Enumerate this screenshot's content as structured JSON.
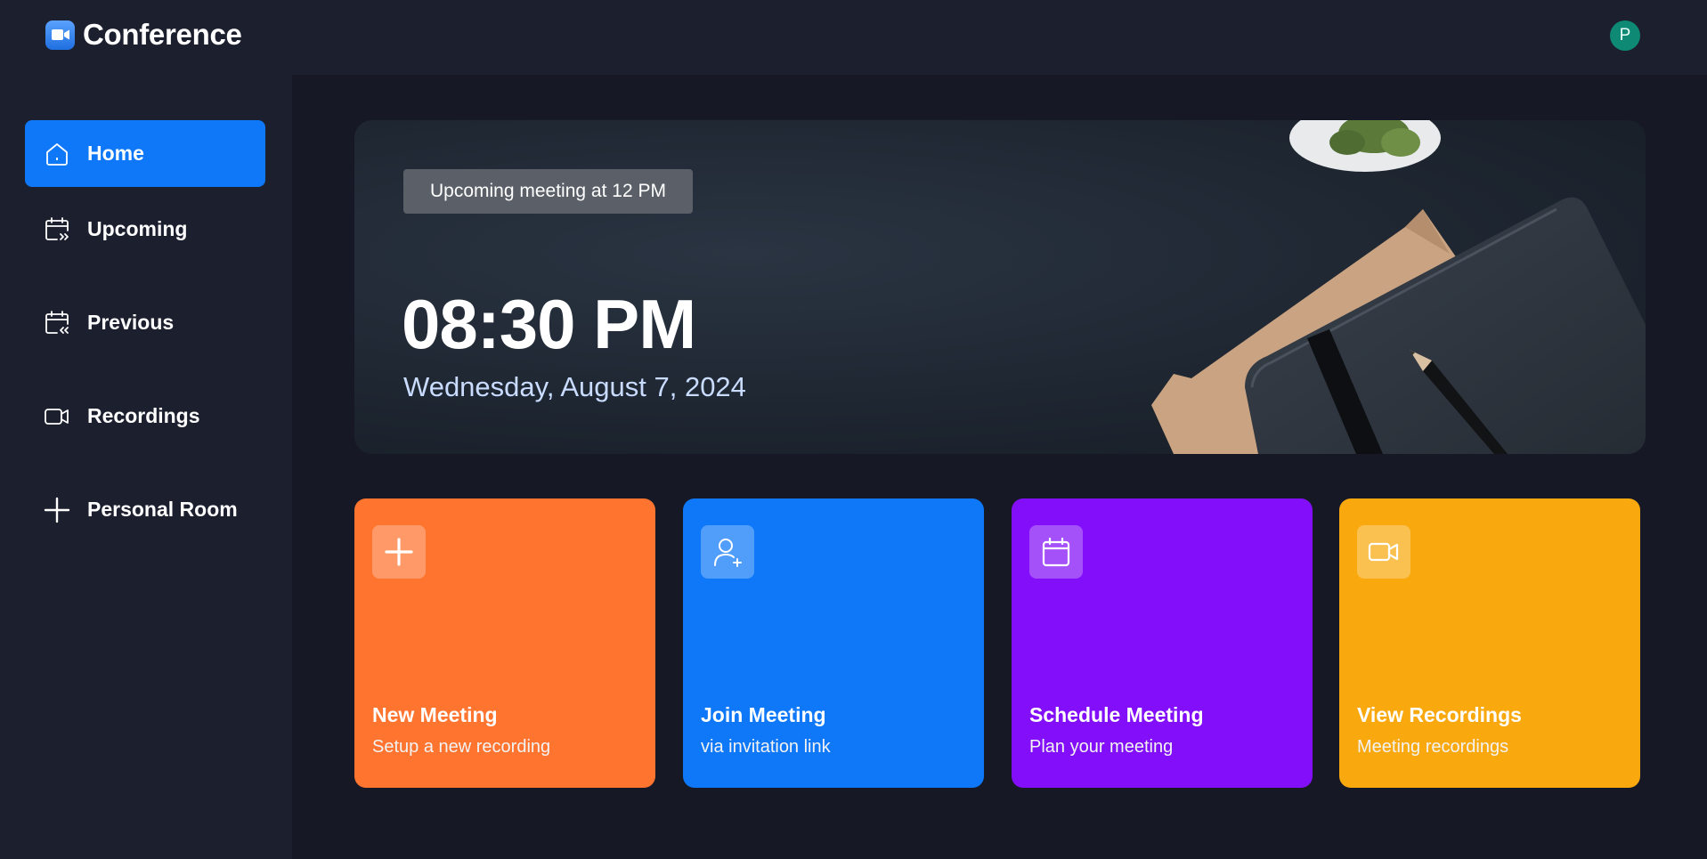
{
  "app": {
    "title": "Conference",
    "logo_icon": "video-camera-logo-icon",
    "user_initial": "P",
    "avatar_color": "#0e8a74"
  },
  "sidebar": {
    "items": [
      {
        "label": "Home",
        "icon": "home-icon",
        "active": true
      },
      {
        "label": "Upcoming",
        "icon": "calendar-forward-icon",
        "active": false
      },
      {
        "label": "Previous",
        "icon": "calendar-back-icon",
        "active": false
      },
      {
        "label": "Recordings",
        "icon": "video-icon",
        "active": false
      },
      {
        "label": "Personal Room",
        "icon": "plus-icon",
        "active": false
      }
    ],
    "active_color": "#0e78f9"
  },
  "hero": {
    "badge": "Upcoming meeting at 12 PM",
    "time": "08:30 PM",
    "date": "Wednesday, August 7, 2024"
  },
  "cards": [
    {
      "title": "New Meeting",
      "subtitle": "Setup a new recording",
      "icon": "plus-icon",
      "color": "#ff742e"
    },
    {
      "title": "Join Meeting",
      "subtitle": "via invitation link",
      "icon": "add-user-icon",
      "color": "#0e78f9"
    },
    {
      "title": "Schedule Meeting",
      "subtitle": "Plan your meeting",
      "icon": "calendar-icon",
      "color": "#830ef9"
    },
    {
      "title": "View Recordings",
      "subtitle": "Meeting recordings",
      "icon": "video-icon",
      "color": "#f9a90e"
    }
  ]
}
